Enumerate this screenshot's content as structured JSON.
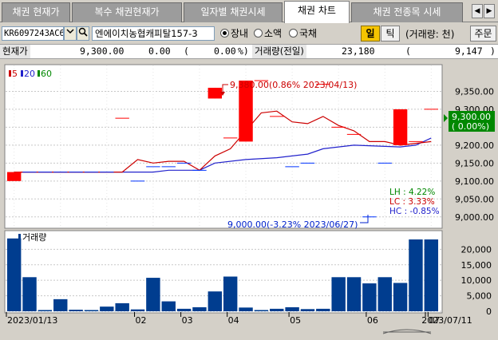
{
  "tabs": [
    {
      "label": "채권 현재가",
      "active": false
    },
    {
      "label": "복수 채권현재가",
      "active": false
    },
    {
      "label": "일자별 채권시세",
      "active": false
    },
    {
      "label": "채권 차트",
      "active": true
    },
    {
      "label": "채권 전종목 시세",
      "active": false
    }
  ],
  "tab_nav": {
    "prev": "◀",
    "next": "▶"
  },
  "toolbar": {
    "code": "KR6097243AC6",
    "name": "엔에이치농협캐피탈157-3",
    "market_options": [
      {
        "label": "장내",
        "selected": true
      },
      {
        "label": "소액",
        "selected": false
      },
      {
        "label": "국채",
        "selected": false
      }
    ],
    "day_button": "일",
    "tick_button": "틱",
    "volume_unit": "(거래량: 천)",
    "order_button": "주문"
  },
  "price_row": {
    "price_label": "현재가",
    "price": "9,300.00",
    "change": "0.00",
    "change_rate_open": "(",
    "change_rate": "0.00",
    "change_rate_close": "%)",
    "volume_label": "거래량(전일)",
    "volume": "23,180",
    "prev_open": "(",
    "prev_volume": "9,147",
    "prev_close": ")"
  },
  "legend": {
    "ma5": "5",
    "ma20": "20",
    "ma60": "60"
  },
  "annotations": {
    "high": "9,380.00(0.86% 2023/04/13)",
    "low": "9,000.00(-3.23% 2023/06/27)",
    "current_price": "9,300.00",
    "current_rate": "( 0.00%)",
    "lh": "LH :  4.22%",
    "lc": "LC :  3.33%",
    "hc": "HC : -0.85%"
  },
  "volume_panel_label": "거래량",
  "colors": {
    "up": "#ff0000",
    "down": "#0033ff",
    "ma5": "#cc0000",
    "ma20": "#2222cc",
    "ma60": "#008800",
    "volume": "#003d8f",
    "grid": "#c8c8c8"
  },
  "chart_data": {
    "type": "candlestick",
    "price_axis": {
      "ticks": [
        9000,
        9050,
        9100,
        9150,
        9200,
        9250,
        9300,
        9350
      ],
      "tick_labels": [
        "9,000.00",
        "9,050.00",
        "9,100.00",
        "9,150.00",
        "9,200.00",
        "9,250.00",
        "9,300.00",
        "9,350.00"
      ]
    },
    "volume_axis": {
      "ticks": [
        0,
        5000,
        10000,
        15000,
        20000
      ],
      "tick_labels": [
        "0",
        "5,000",
        "10,000",
        "15,000",
        "20,000"
      ]
    },
    "x_labels": [
      {
        "label": "2023/01/13",
        "index": 0
      },
      {
        "label": "02",
        "index": 8
      },
      {
        "label": "03",
        "index": 11
      },
      {
        "label": "04",
        "index": 14
      },
      {
        "label": "05",
        "index": 18
      },
      {
        "label": "06",
        "index": 23
      },
      {
        "label": "07",
        "index": 27
      },
      {
        "label": "2023/07/11",
        "index": 29
      }
    ],
    "candles": [
      {
        "o": 9100,
        "h": 9100,
        "l": 9100,
        "c": 9125,
        "vol": 23500
      },
      {
        "o": 9125,
        "h": 9125,
        "l": 9125,
        "c": 9125,
        "vol": 11000
      },
      {
        "o": 9125,
        "h": 9125,
        "l": 9125,
        "c": 9125,
        "vol": 400
      },
      {
        "o": 9125,
        "h": 9125,
        "l": 9125,
        "c": 9125,
        "vol": 3900
      },
      {
        "o": 9125,
        "h": 9125,
        "l": 9125,
        "c": 9125,
        "vol": 500
      },
      {
        "o": 9125,
        "h": 9125,
        "l": 9125,
        "c": 9125,
        "vol": 400
      },
      {
        "o": 9125,
        "h": 9125,
        "l": 9125,
        "c": 9125,
        "vol": 1500
      },
      {
        "o": 9275,
        "h": 9275,
        "l": 9275,
        "c": 9275,
        "vol": 2600
      },
      {
        "o": 9100,
        "h": 9100,
        "l": 9100,
        "c": 9100,
        "vol": 600
      },
      {
        "o": 9140,
        "h": 9140,
        "l": 9140,
        "c": 9140,
        "vol": 10800
      },
      {
        "o": 9140,
        "h": 9140,
        "l": 9140,
        "c": 9140,
        "vol": 3200
      },
      {
        "o": 9150,
        "h": 9150,
        "l": 9150,
        "c": 9150,
        "vol": 800
      },
      {
        "o": 9130,
        "h": 9130,
        "l": 9130,
        "c": 9130,
        "vol": 1300
      },
      {
        "o": 9330,
        "h": 9360,
        "l": 9330,
        "c": 9360,
        "vol": 6400
      },
      {
        "o": 9220,
        "h": 9220,
        "l": 9220,
        "c": 9220,
        "vol": 11200
      },
      {
        "o": 9210,
        "h": 9380,
        "l": 9210,
        "c": 9380,
        "vol": 1200
      },
      {
        "o": 9380,
        "h": 9380,
        "l": 9380,
        "c": 9380,
        "vol": 400
      },
      {
        "o": 9280,
        "h": 9280,
        "l": 9280,
        "c": 9280,
        "vol": 800
      },
      {
        "o": 9140,
        "h": 9140,
        "l": 9140,
        "c": 9140,
        "vol": 1300
      },
      {
        "o": 9150,
        "h": 9150,
        "l": 9150,
        "c": 9150,
        "vol": 700
      },
      {
        "o": 9370,
        "h": 9370,
        "l": 9370,
        "c": 9370,
        "vol": 800
      },
      {
        "o": 9250,
        "h": 9250,
        "l": 9250,
        "c": 9250,
        "vol": 11000
      },
      {
        "o": 9230,
        "h": 9230,
        "l": 9230,
        "c": 9230,
        "vol": 11000
      },
      {
        "o": 9000,
        "h": 9000,
        "l": 9000,
        "c": 9000,
        "vol": 9000
      },
      {
        "o": 9150,
        "h": 9150,
        "l": 9150,
        "c": 9150,
        "vol": 11000
      },
      {
        "o": 9200,
        "h": 9300,
        "l": 9200,
        "c": 9300,
        "vol": 9147
      },
      {
        "o": 9210,
        "h": 9210,
        "l": 9210,
        "c": 9210,
        "vol": 23180
      },
      {
        "o": 9300,
        "h": 9300,
        "l": 9300,
        "c": 9300,
        "vol": 23180
      }
    ],
    "ma5": [
      [
        0,
        9125
      ],
      [
        7,
        9125
      ],
      [
        8,
        9160
      ],
      [
        9,
        9150
      ],
      [
        10,
        9155
      ],
      [
        11,
        9155
      ],
      [
        12,
        9130
      ],
      [
        13,
        9170
      ],
      [
        14,
        9190
      ],
      [
        15,
        9240
      ],
      [
        16,
        9290
      ],
      [
        17,
        9295
      ],
      [
        18,
        9265
      ],
      [
        19,
        9260
      ],
      [
        20,
        9280
      ],
      [
        21,
        9255
      ],
      [
        22,
        9240
      ],
      [
        23,
        9210
      ],
      [
        24,
        9210
      ],
      [
        25,
        9200
      ],
      [
        26,
        9205
      ],
      [
        27,
        9210
      ]
    ],
    "ma20": [
      [
        0,
        9125
      ],
      [
        9,
        9125
      ],
      [
        10,
        9130
      ],
      [
        12,
        9130
      ],
      [
        13,
        9150
      ],
      [
        15,
        9160
      ],
      [
        17,
        9165
      ],
      [
        19,
        9175
      ],
      [
        20,
        9190
      ],
      [
        21,
        9195
      ],
      [
        22,
        9200
      ],
      [
        25,
        9195
      ],
      [
        26,
        9200
      ],
      [
        27,
        9220
      ]
    ],
    "ma60": []
  }
}
